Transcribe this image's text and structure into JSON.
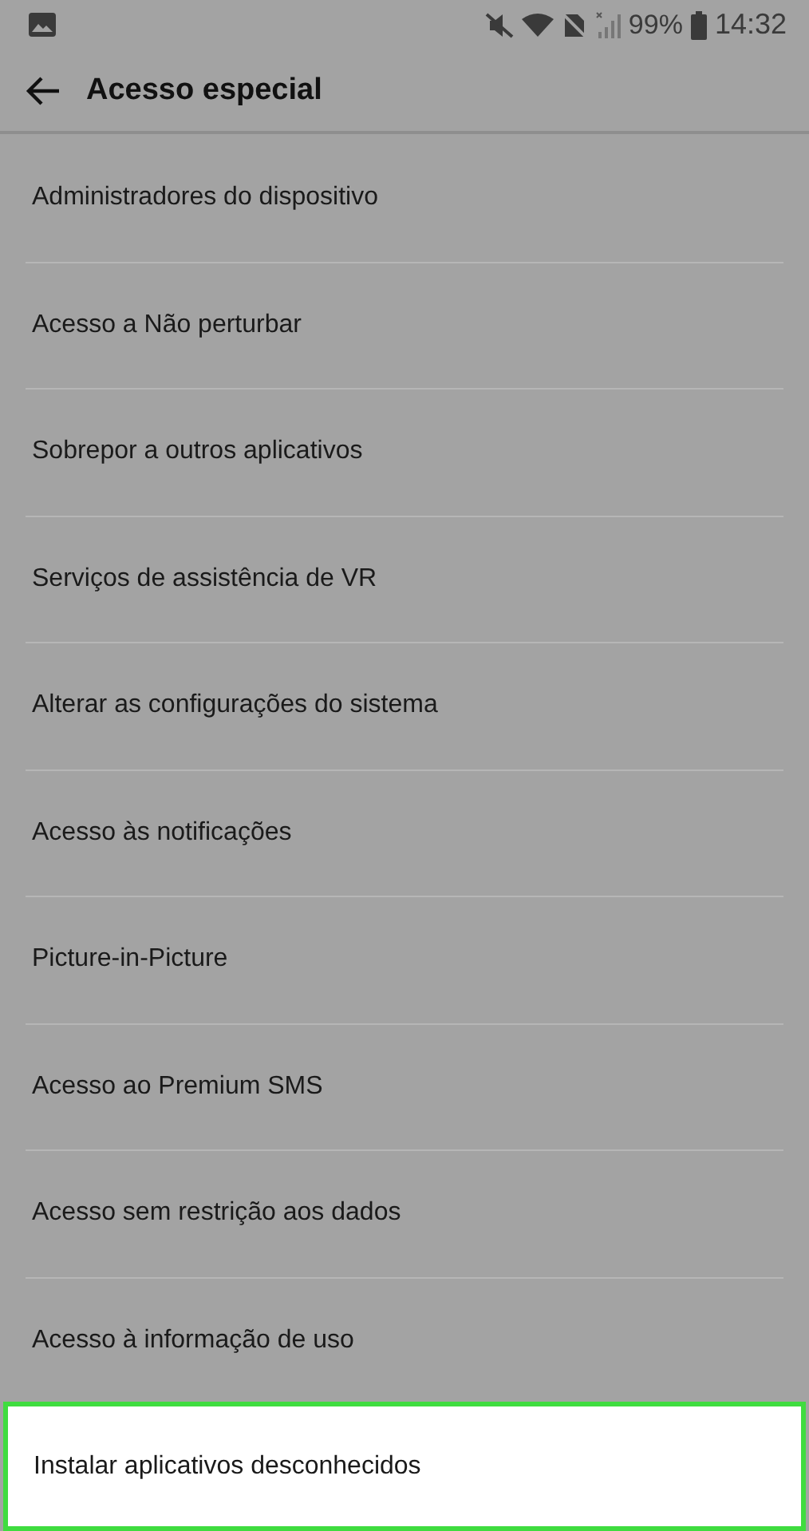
{
  "status_bar": {
    "battery": "99%",
    "time": "14:32"
  },
  "header": {
    "title": "Acesso especial"
  },
  "items": [
    {
      "label": "Administradores do dispositivo",
      "selected": false
    },
    {
      "label": "Acesso a Não perturbar",
      "selected": false
    },
    {
      "label": "Sobrepor a outros aplicativos",
      "selected": false
    },
    {
      "label": "Serviços de assistência de VR",
      "selected": false
    },
    {
      "label": "Alterar as configurações do sistema",
      "selected": false
    },
    {
      "label": "Acesso às notificações",
      "selected": false
    },
    {
      "label": "Picture-in-Picture",
      "selected": false
    },
    {
      "label": "Acesso ao Premium SMS",
      "selected": false
    },
    {
      "label": "Acesso sem restrição aos dados",
      "selected": false
    },
    {
      "label": "Acesso à informação de uso",
      "selected": false
    },
    {
      "label": "Instalar aplicativos desconhecidos",
      "selected": true
    }
  ]
}
